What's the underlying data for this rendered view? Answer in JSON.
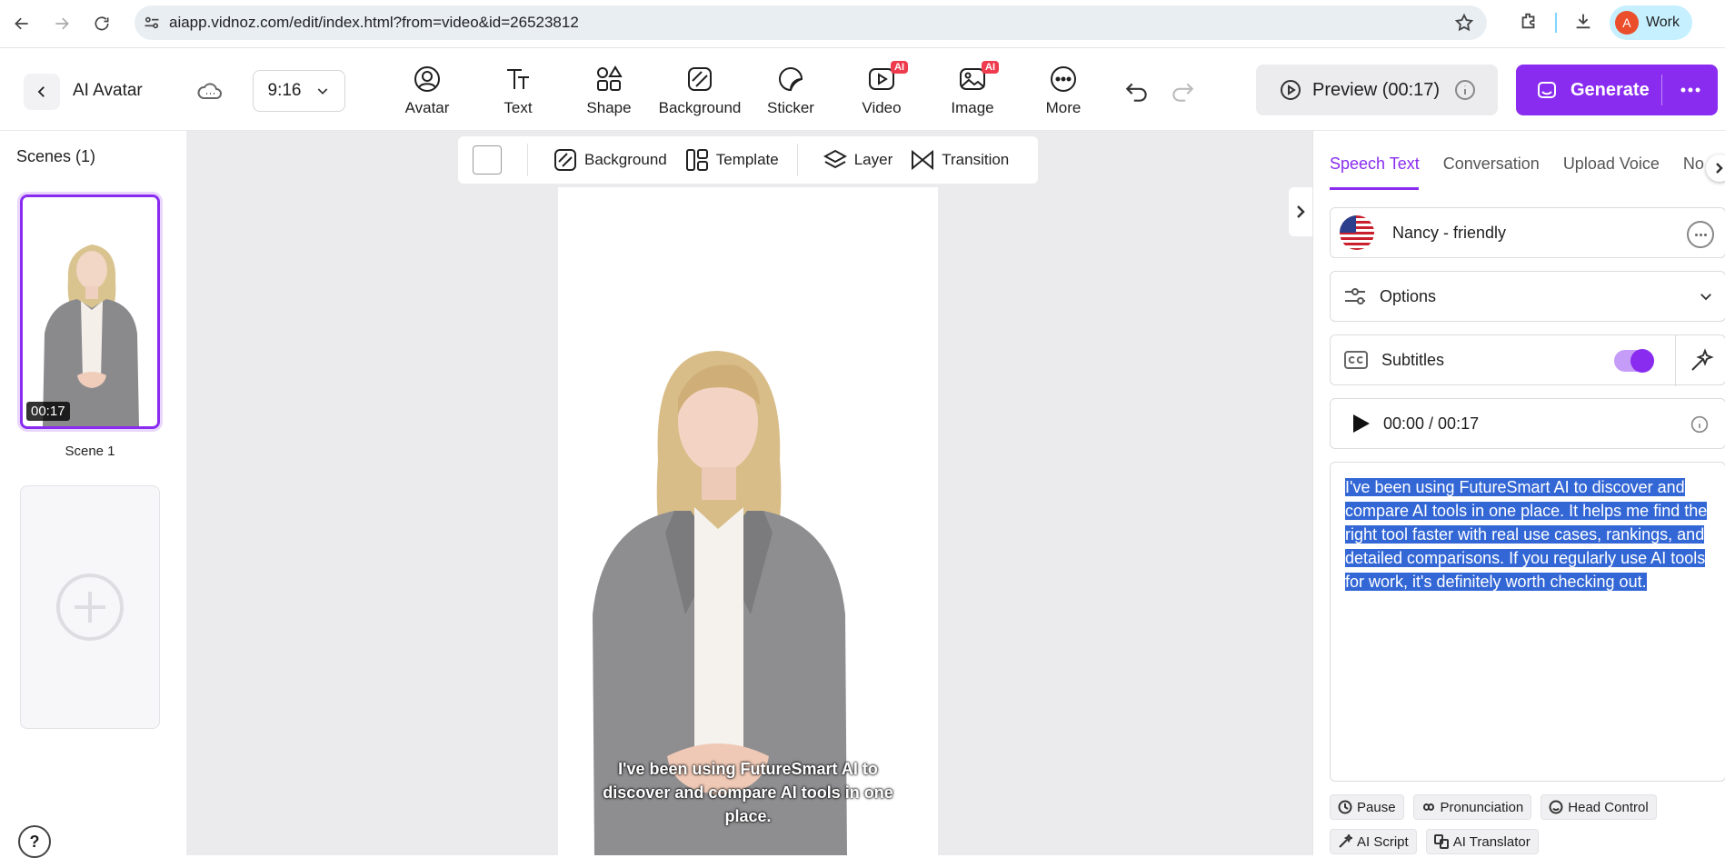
{
  "browser": {
    "url": "aiapp.vidnoz.com/edit/index.html?from=video&id=26523812",
    "profile_initial": "A",
    "profile_name": "Work"
  },
  "header": {
    "title": "AI Avatar",
    "aspect_ratio": "9:16",
    "tools": [
      {
        "label": "Avatar",
        "icon": "avatar-icon"
      },
      {
        "label": "Text",
        "icon": "text-icon"
      },
      {
        "label": "Shape",
        "icon": "shape-icon"
      },
      {
        "label": "Background",
        "icon": "background-icon"
      },
      {
        "label": "Sticker",
        "icon": "sticker-icon"
      },
      {
        "label": "Video",
        "icon": "video-icon",
        "badge": "AI"
      },
      {
        "label": "Image",
        "icon": "image-icon",
        "badge": "AI"
      },
      {
        "label": "More",
        "icon": "more-icon"
      }
    ],
    "preview_label": "Preview (00:17)",
    "generate_label": "Generate"
  },
  "scenes": {
    "title": "Scenes (1)",
    "items": [
      {
        "label": "Scene 1",
        "duration": "00:17"
      }
    ]
  },
  "canvas": {
    "toolbar": {
      "background": "Background",
      "template": "Template",
      "layer": "Layer",
      "transition": "Transition"
    },
    "subtitle": "I've been using FutureSmart AI to discover and compare AI tools in one place."
  },
  "panel": {
    "tabs": [
      "Speech Text",
      "Conversation",
      "Upload Voice",
      "No"
    ],
    "voice_name": "Nancy - friendly",
    "options_label": "Options",
    "subtitles_label": "Subtitles",
    "subtitles_on": true,
    "player_time": "00:00 / 00:17",
    "script_text": "I've been using FutureSmart AI to discover and compare AI tools in one place. It helps me find the right tool faster with real use cases, rankings, and detailed comparisons. If you regularly use AI tools for work, it's definitely worth checking out.",
    "chips": [
      "Pause",
      "Pronunciation",
      "Head Control",
      "AI Script",
      "AI Translator"
    ]
  },
  "colors": {
    "accent": "#8a2cf0",
    "selection": "#3367d6",
    "badge": "#ee3b4d"
  }
}
